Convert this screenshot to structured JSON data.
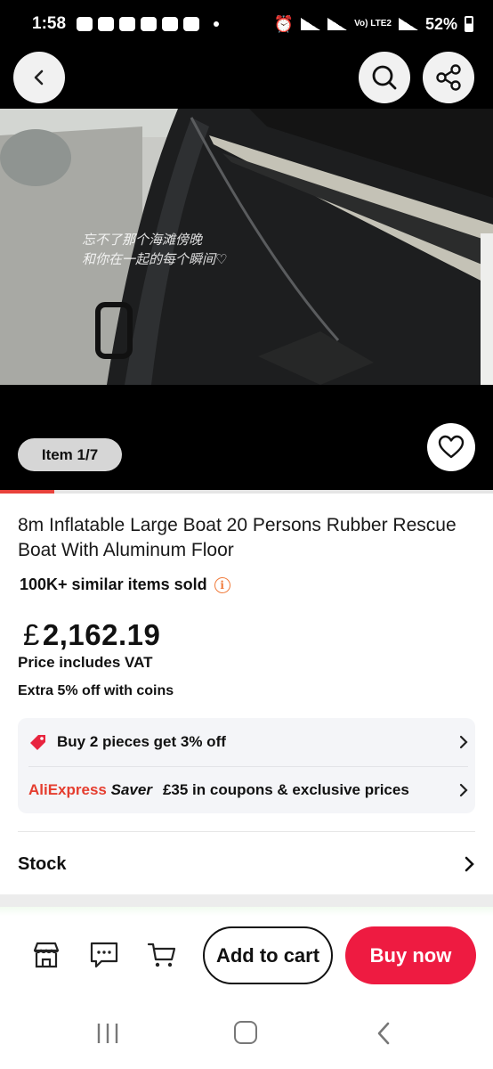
{
  "status_bar": {
    "time": "1:58",
    "network": "Vo) LTE2",
    "battery": "52%"
  },
  "header": {
    "back_icon": "chevron-left-icon",
    "search_icon": "search-icon",
    "share_icon": "share-icon"
  },
  "gallery": {
    "image_overlay_text_line1": "忘不了那个海滩傍晚",
    "image_overlay_text_line2": "和你在一起的每个瞬间♡",
    "item_badge": "Item 1/7",
    "favorite_icon": "heart-outline-icon",
    "progress_fraction": 0.11
  },
  "product": {
    "title": "8m Inflatable Large Boat 20 Persons Rubber Rescue Boat With Aluminum Floor",
    "sold": "100K+ similar items sold",
    "currency": "£",
    "price": "2,162.19",
    "vat_note": "Price includes VAT",
    "coins_note": "Extra 5% off with coins"
  },
  "promotions": {
    "bundle": "Buy 2 pieces get 3% off",
    "saver_brand": "AliExpress",
    "saver_word": "Saver",
    "coupons": "£35 in coupons & exclusive prices"
  },
  "sections": {
    "stock": "Stock"
  },
  "action_bar": {
    "store_icon": "store-icon",
    "message_icon": "message-icon",
    "cart_icon": "cart-icon",
    "add_to_cart": "Add to cart",
    "buy_now": "Buy now"
  },
  "colors": {
    "accent": "#ee1b41",
    "info_orange": "#f07a3a",
    "progress_red": "#e8423b"
  }
}
